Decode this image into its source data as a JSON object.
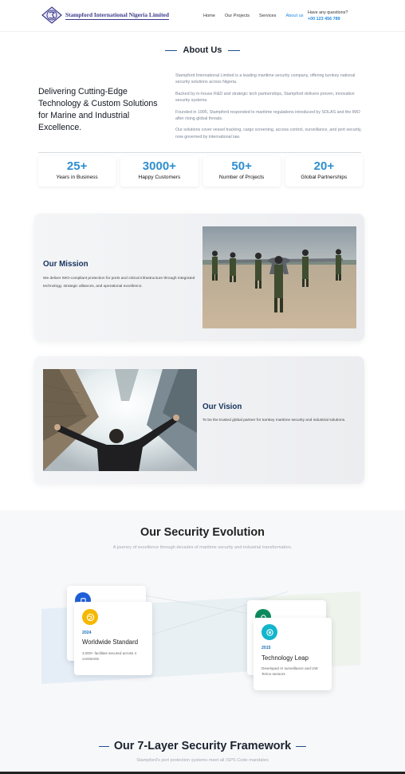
{
  "header": {
    "logo_text": "Stampford International Nigeria Limited",
    "nav": [
      {
        "label": "Home",
        "active": false
      },
      {
        "label": "Our Projects",
        "active": false
      },
      {
        "label": "Services",
        "active": false
      },
      {
        "label": "About us",
        "active": true
      }
    ],
    "contact_question": "Have any questions?",
    "contact_phone": "+00 123 456 789"
  },
  "about": {
    "heading": "About Us",
    "tagline": "Delivering Cutting-Edge Technology & Custom Solutions for Marine and Industrial Excellence.",
    "paragraphs": [
      "Stampford International Limited is a leading maritime security company, offering turnkey national security solutions across Nigeria.",
      "Backed by in-house R&D and strategic tech partnerships, Stampford delivers proven, innovative security systems.",
      "Founded in 1995, Stampford responded to maritime regulations introduced by SOLAS and the IMO after rising global threats.",
      "Our solutions cover vessel tracking, cargo screening, access control, surveillance, and port security, now governed by international law."
    ],
    "stats": [
      {
        "value": "25+",
        "label": "Years in Business"
      },
      {
        "value": "3000+",
        "label": "Happy Customers"
      },
      {
        "value": "50+",
        "label": "Number of Projects"
      },
      {
        "value": "20+",
        "label": "Global Partnerships"
      }
    ]
  },
  "mission": {
    "title": "Our Mission",
    "text": "We deliver IMO-compliant protection for ports and critical infrastructure through integrated technology, strategic alliances, and operational excellence."
  },
  "vision": {
    "title": "Our Vision",
    "text": "To be the trusted global partner for turnkey maritime security and industrial solutions."
  },
  "evolution": {
    "title": "Our Security Evolution",
    "subtitle": "A journey of excellence through decades of maritime security and industrial transformation.",
    "timeline": [
      {
        "year": "2024",
        "title": "Worldwide Standard",
        "desc": "3,000+ facilities secured across 4 continents",
        "color": "#f5b800",
        "icon": "globe-icon"
      },
      {
        "year": "2015",
        "title": "Technology Leap",
        "desc": "Developed AI surveillance and UW Terice sensors",
        "color": "#12b5cb",
        "icon": "chip-icon"
      }
    ],
    "back_card_colors": [
      "#1e5fd8",
      "#0e8a5f"
    ]
  },
  "framework": {
    "title": "Our 7-Layer Security Framework",
    "subtitle": "Stampford's port protection systems meet all ISPS Code mandates"
  }
}
